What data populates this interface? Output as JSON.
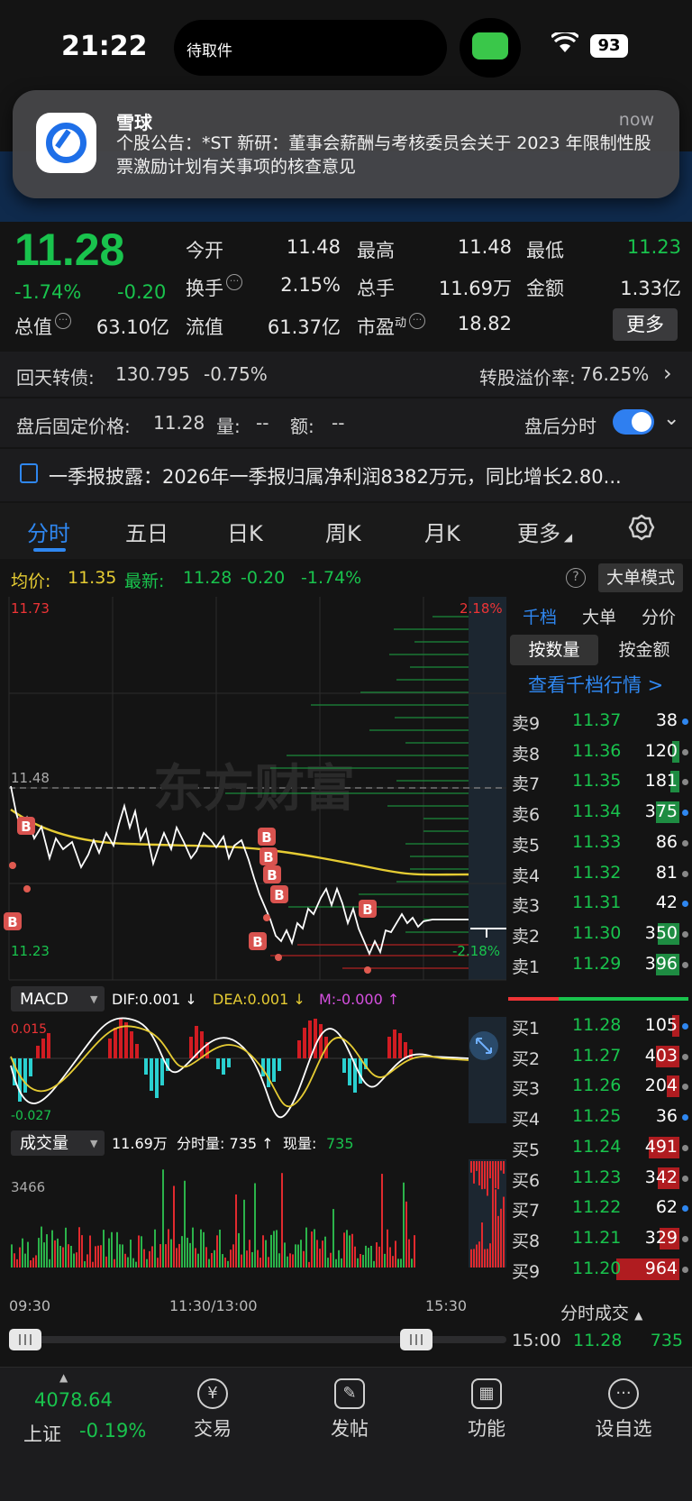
{
  "status_bar": {
    "time": "21:22",
    "island_text": "待取件",
    "battery": "93"
  },
  "notification": {
    "app": "雪球",
    "time": "now",
    "body": "个股公告：*ST 新研：董事会薪酬与考核委员会关于 2023 年限制性股票激励计划有关事项的核查意见"
  },
  "quote": {
    "price": "11.28",
    "change_pct": "-1.74%",
    "change": "-0.20",
    "stats": [
      {
        "label": "今开",
        "value": "11.48"
      },
      {
        "label": "最高",
        "value": "11.48"
      },
      {
        "label": "最低",
        "value": "11.23"
      },
      {
        "label": "换手",
        "value": "2.15%"
      },
      {
        "label": "总手",
        "value": "11.69万"
      },
      {
        "label": "金额",
        "value": "1.33亿"
      },
      {
        "label": "总值",
        "value": "63.10亿"
      },
      {
        "label": "流值",
        "value": "61.37亿"
      },
      {
        "label": "市盈",
        "label_sup": "动",
        "value": "18.82"
      }
    ],
    "more_label": "更多"
  },
  "convertible": {
    "label": "回天转债:",
    "price": "130.795",
    "pct": "-0.75%",
    "premium_label": "转股溢价率:",
    "premium": "76.25%"
  },
  "after_hours": {
    "label": "盘后固定价格:",
    "price": "11.28",
    "vol_label": "量:",
    "vol": "--",
    "amt_label": "额:",
    "amt": "--",
    "toggle_label": "盘后分时",
    "toggle_on": true
  },
  "news": {
    "text": "一季报披露：2026年一季报归属净利润8382万元，同比增长2.80..."
  },
  "tabs": [
    "分时",
    "五日",
    "日K",
    "周K",
    "月K",
    "更多"
  ],
  "active_tab": 0,
  "avg_bar": {
    "avg_label": "均价:",
    "avg": "11.35",
    "latest_label": "最新:",
    "latest": "11.28",
    "chg": "-0.20",
    "pct": "-1.74%",
    "big_order_mode": "大单模式"
  },
  "chart_labels": {
    "price_high": "11.73",
    "pct_high": "2.18%",
    "open_level": "11.48",
    "price_low": "11.23",
    "pct_low": "-2.18%",
    "watermark": "东方财富",
    "buy_marker": "B"
  },
  "macd": {
    "name": "MACD",
    "dif": "DIF:0.001 ↓",
    "dea": "DEA:0.001 ↓",
    "m": "M:-0.000 ↑",
    "top": "0.015",
    "bottom": "-0.027"
  },
  "volume": {
    "name": "成交量",
    "total": "11.69万",
    "tick_label": "分时量: 735 ↑",
    "now_label": "现量:",
    "now": "735",
    "max": "3466"
  },
  "time_axis": [
    "09:30",
    "11:30/13:00",
    "15:30"
  ],
  "order_book": {
    "tabs": [
      "千档",
      "大单",
      "分价"
    ],
    "segments": [
      "按数量",
      "按金额"
    ],
    "link": "查看千档行情 >",
    "asks": [
      {
        "label": "卖9",
        "price": "11.37",
        "vol": "38"
      },
      {
        "label": "卖8",
        "price": "11.36",
        "vol": "120"
      },
      {
        "label": "卖7",
        "price": "11.35",
        "vol": "181"
      },
      {
        "label": "卖6",
        "price": "11.34",
        "vol": "375"
      },
      {
        "label": "卖5",
        "price": "11.33",
        "vol": "86"
      },
      {
        "label": "卖4",
        "price": "11.32",
        "vol": "81"
      },
      {
        "label": "卖3",
        "price": "11.31",
        "vol": "42"
      },
      {
        "label": "卖2",
        "price": "11.30",
        "vol": "350"
      },
      {
        "label": "卖1",
        "price": "11.29",
        "vol": "396"
      }
    ],
    "bids": [
      {
        "label": "买1",
        "price": "11.28",
        "vol": "105"
      },
      {
        "label": "买2",
        "price": "11.27",
        "vol": "403"
      },
      {
        "label": "买3",
        "price": "11.26",
        "vol": "204"
      },
      {
        "label": "买4",
        "price": "11.25",
        "vol": "36"
      },
      {
        "label": "买5",
        "price": "11.24",
        "vol": "491"
      },
      {
        "label": "买6",
        "price": "11.23",
        "vol": "342"
      },
      {
        "label": "买7",
        "price": "11.22",
        "vol": "62"
      },
      {
        "label": "买8",
        "price": "11.21",
        "vol": "329"
      },
      {
        "label": "买9",
        "price": "11.20",
        "vol": "964"
      }
    ],
    "tick_header": "分时成交",
    "last_tick": {
      "time": "15:00",
      "price": "11.28",
      "vol": "735"
    }
  },
  "bottom_nav": {
    "index_value": "4078.64",
    "index_name": "上证",
    "index_pct": "-0.19%",
    "items": [
      {
        "label": "交易",
        "icon": "yen-cycle-icon"
      },
      {
        "label": "发帖",
        "icon": "edit-icon"
      },
      {
        "label": "功能",
        "icon": "grid-icon"
      },
      {
        "label": "设自选",
        "icon": "more-dots-icon"
      }
    ]
  },
  "colors": {
    "up": "#ee3436",
    "down": "#19c34d",
    "accent": "#2f87f0",
    "avg_line": "#e6cc33"
  }
}
